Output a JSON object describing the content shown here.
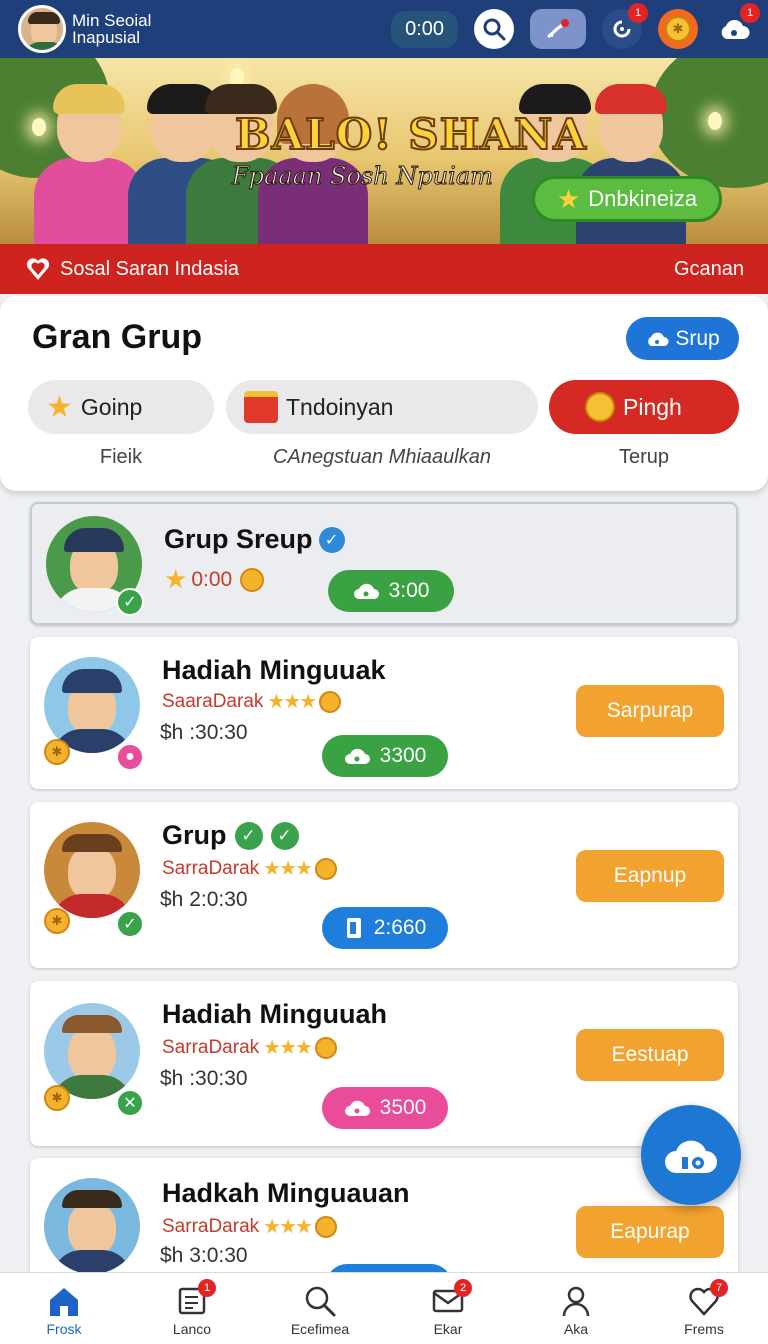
{
  "header": {
    "app_title": "Min Seoial Inapusial",
    "timer": "0:00",
    "notif_badges": [
      "1",
      "1"
    ]
  },
  "banner": {
    "title": "BALO! SHANA",
    "subtitle": "Fpaaan Sosh Npuiam",
    "button_label": "Dnbkineiza"
  },
  "red_bar": {
    "label": "Sosal Saran Indasia",
    "right_label": "Gcanan"
  },
  "group": {
    "title": "Gran Grup",
    "srup_label": "Srup",
    "filters": [
      {
        "label": "Goinp",
        "caption": "Fieik"
      },
      {
        "label": "Tndoinyan",
        "caption": "CAnegstuan Mhiaaulkan"
      },
      {
        "label": "Pingh",
        "caption": "Terup"
      }
    ]
  },
  "items": [
    {
      "title": "Grup Sreup",
      "sub": "0:00",
      "chip": "3:00"
    },
    {
      "title": "Hadiah Minguuak",
      "sub": "SaaraDarak",
      "time": "$h :30:30",
      "chip": "3300",
      "action": "Sarpurap"
    },
    {
      "title": "Grup",
      "sub": "SarraDarak",
      "time": "$h 2:0:30",
      "chip": "2:660",
      "action": "Eapnup"
    },
    {
      "title": "Hadiah Minguuah",
      "sub": "SarraDarak",
      "time": "$h :30:30",
      "chip": "3500",
      "action": "Eestuap"
    },
    {
      "title": "Hadkah Minguauan",
      "sub": "SarraDarak",
      "time": "$h 3:0:30",
      "action": "Eapurap"
    }
  ],
  "bottom_nav": [
    {
      "label": "Frosk",
      "icon": "home-icon",
      "active": true
    },
    {
      "label": "Lanco",
      "icon": "notes-icon",
      "badge": "1"
    },
    {
      "label": "Ecefimea",
      "icon": "search-icon"
    },
    {
      "label": "Ekar",
      "icon": "mail-icon",
      "badge": "2"
    },
    {
      "label": "Aka",
      "icon": "person-icon"
    },
    {
      "label": "Frems",
      "icon": "heart-icon",
      "badge": "7"
    }
  ],
  "colors": {
    "header": "#1f3f7a",
    "red_bar": "#cf2320",
    "action": "#f2a32f",
    "chip_green": "#3ba243",
    "chip_blue": "#1f7edb",
    "chip_pink": "#e94c9a",
    "primary": "#1f74d8"
  }
}
